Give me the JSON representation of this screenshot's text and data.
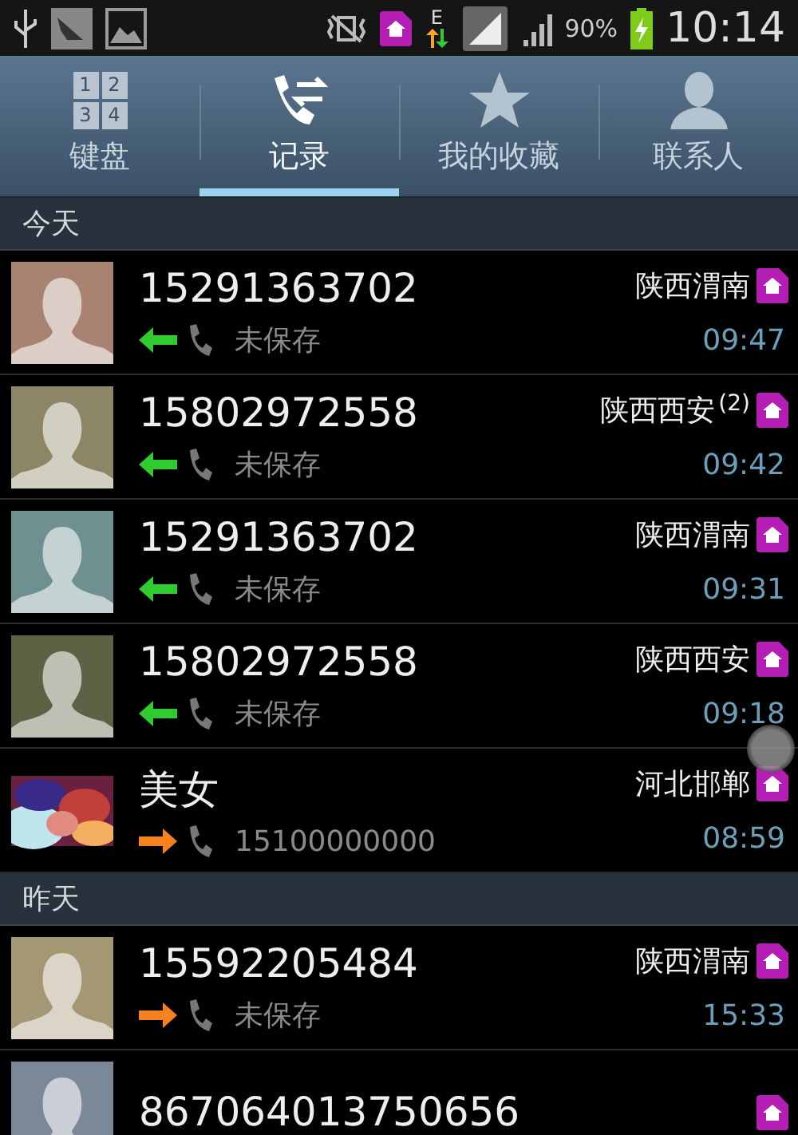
{
  "status_bar": {
    "network_type": "E",
    "battery": "90%",
    "time": "10:14"
  },
  "tabs": [
    {
      "label": "键盘",
      "kind": "keypad",
      "keys": [
        "1",
        "2",
        "3",
        "4"
      ],
      "selected": false
    },
    {
      "label": "记录",
      "kind": "log",
      "selected": true
    },
    {
      "label": "我的收藏",
      "kind": "star",
      "selected": false
    },
    {
      "label": "联系人",
      "kind": "person",
      "selected": false
    }
  ],
  "sections": [
    {
      "title": "今天",
      "calls": [
        {
          "name": "15291363702",
          "avatar": {
            "kind": "person",
            "color": "#a88372"
          },
          "kind": "incoming",
          "detail": "未保存",
          "location": "陕西渭南",
          "time": "09:47"
        },
        {
          "name": "15802972558",
          "avatar": {
            "kind": "person",
            "color": "#8c8666"
          },
          "kind": "incoming",
          "detail": "未保存",
          "location": "陕西西安",
          "count": "(2)",
          "time": "09:42"
        },
        {
          "name": "15291363702",
          "avatar": {
            "kind": "person",
            "color": "#6f9090"
          },
          "kind": "incoming",
          "detail": "未保存",
          "location": "陕西渭南",
          "time": "09:31"
        },
        {
          "name": "15802972558",
          "avatar": {
            "kind": "person",
            "color": "#5c6244"
          },
          "kind": "incoming",
          "detail": "未保存",
          "location": "陕西西安",
          "time": "09:18"
        },
        {
          "name": "美女",
          "kind": "outgoing",
          "detail": "15100000000",
          "location": "河北邯郸",
          "time": "08:59"
        }
      ]
    },
    {
      "title": "昨天",
      "calls": [
        {
          "name": "15592205484",
          "avatar": {
            "kind": "person",
            "color": "#a49774"
          },
          "kind": "outgoing",
          "detail": "未保存",
          "location": "陕西渭南",
          "time": "15:33"
        },
        {
          "name": "867064013750656",
          "avatar": {
            "kind": "person",
            "color": "#7a8898"
          }
        }
      ]
    }
  ]
}
